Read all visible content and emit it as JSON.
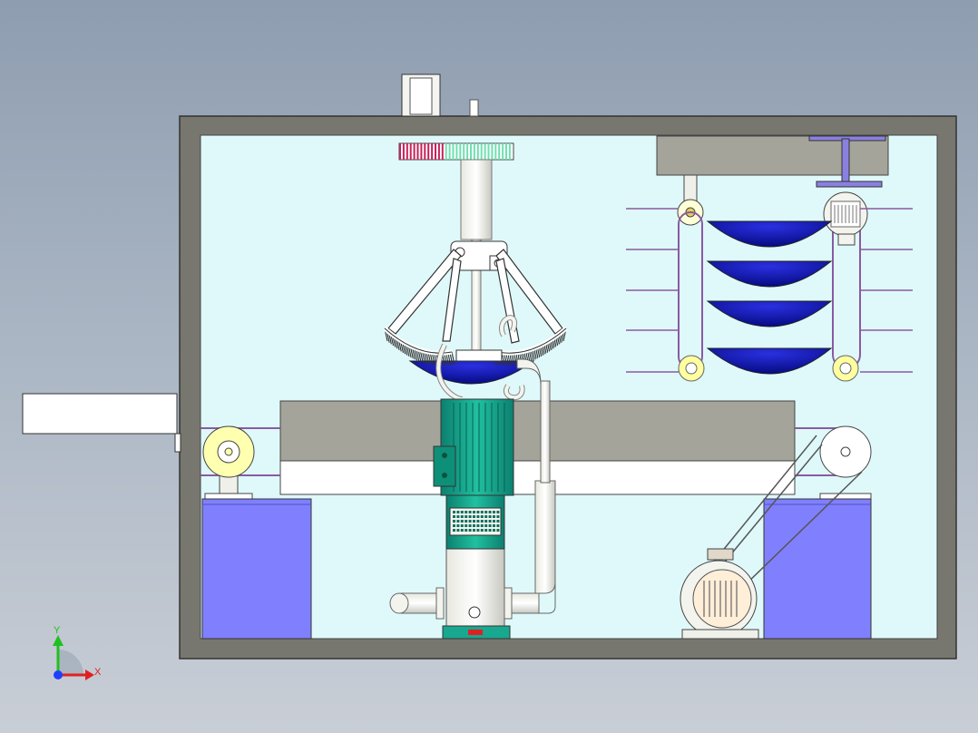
{
  "viewport": {
    "background_top": "#8e9db0",
    "background_bottom": "#c9ced6"
  },
  "colors": {
    "frame": "#77776f",
    "interior": "#dff9fb",
    "tank": "#8080ff",
    "bowl": "#0a10a8",
    "motor_green": "#12a88c",
    "pulley_yellow": "#ffffb0",
    "gear_red": "#c8205a",
    "gear_green": "#6ee0b0",
    "table_grey": "#a4a49a",
    "rack_purple": "#8a5aa0"
  },
  "triad": {
    "y_label": "Y",
    "x_label": "X",
    "y_color": "#20c020",
    "x_color": "#e02020",
    "origin_color": "#2040ff"
  },
  "bowls_count": 4
}
